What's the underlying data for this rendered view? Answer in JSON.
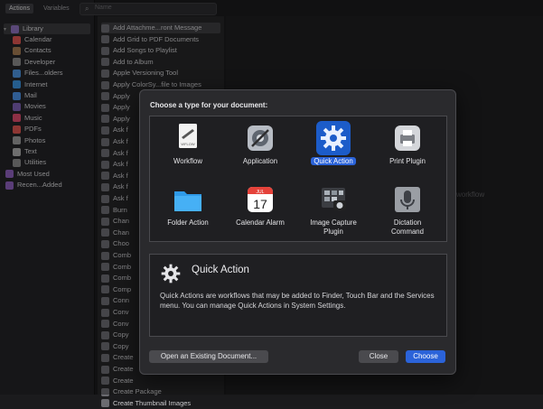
{
  "tabs": [
    "Actions",
    "Variables"
  ],
  "search": {
    "placeholder": "Name"
  },
  "library": {
    "items": [
      {
        "label": "Library",
        "color": "#8b6fb8"
      },
      {
        "label": "Calendar",
        "color": "#d9534f"
      },
      {
        "label": "Contacts",
        "color": "#a07850"
      },
      {
        "label": "Developer",
        "color": "#888888"
      },
      {
        "label": "Files...olders",
        "color": "#4a8fd9"
      },
      {
        "label": "Internet",
        "color": "#3a8fd9"
      },
      {
        "label": "Mail",
        "color": "#4a90e2"
      },
      {
        "label": "Movies",
        "color": "#7a5fb0"
      },
      {
        "label": "Music",
        "color": "#d94a6a"
      },
      {
        "label": "PDFs",
        "color": "#d9534f"
      },
      {
        "label": "Photos",
        "color": "#999999"
      },
      {
        "label": "Text",
        "color": "#aaaaaa"
      },
      {
        "label": "Utilities",
        "color": "#888888"
      },
      {
        "label": "Most Used",
        "color": "#8b5fb8"
      },
      {
        "label": "Recen...Added",
        "color": "#8b5fb8"
      }
    ]
  },
  "actions": [
    "Add Attachme...ront Message",
    "Add Grid to PDF Documents",
    "Add Songs to Playlist",
    "Add to Album",
    "Apple Versioning Tool",
    "Apply ColorSy...file to Images",
    "Apply",
    "Apply",
    "Apply",
    "Ask f",
    "Ask f",
    "Ask f",
    "Ask f",
    "Ask f",
    "Ask f",
    "Ask f",
    "Burn",
    "Chan",
    "Chan",
    "Choo",
    "Comb",
    "Comb",
    "Comb",
    "Comp",
    "Conn",
    "Conv",
    "Conv",
    "Copy",
    "Copy",
    "Create",
    "Create",
    "Create",
    "Create Package",
    "Create Thumbnail Images"
  ],
  "drag_hint": "workflow",
  "dialog": {
    "title": "Choose a type for your document:",
    "types": [
      {
        "label": "Workflow",
        "icon": "workflow-icon"
      },
      {
        "label": "Application",
        "icon": "application-icon"
      },
      {
        "label": "Quick Action",
        "icon": "quick-action-gear-icon"
      },
      {
        "label": "Print Plugin",
        "icon": "printer-icon"
      },
      {
        "label": "Folder Action",
        "icon": "folder-icon"
      },
      {
        "label": "Calendar Alarm",
        "icon": "calendar-icon"
      },
      {
        "label": "Image Capture\nPlugin",
        "icon": "image-capture-icon"
      },
      {
        "label": "Dictation\nCommand",
        "icon": "microphone-icon"
      }
    ],
    "calendar_month": "JUL",
    "calendar_day": "17",
    "workflow_doc_text": "WFLOW",
    "selected_index": 2,
    "description_title": "Quick Action",
    "description_text": "Quick Actions are workflows that may be added to Finder, Touch Bar and the Services menu. You can manage Quick Actions in System Settings.",
    "buttons": {
      "open": "Open an Existing Document...",
      "close": "Close",
      "choose": "Choose"
    }
  },
  "colors": {
    "accent": "#2b63d9",
    "dialog_bg": "#2a2a2d"
  }
}
